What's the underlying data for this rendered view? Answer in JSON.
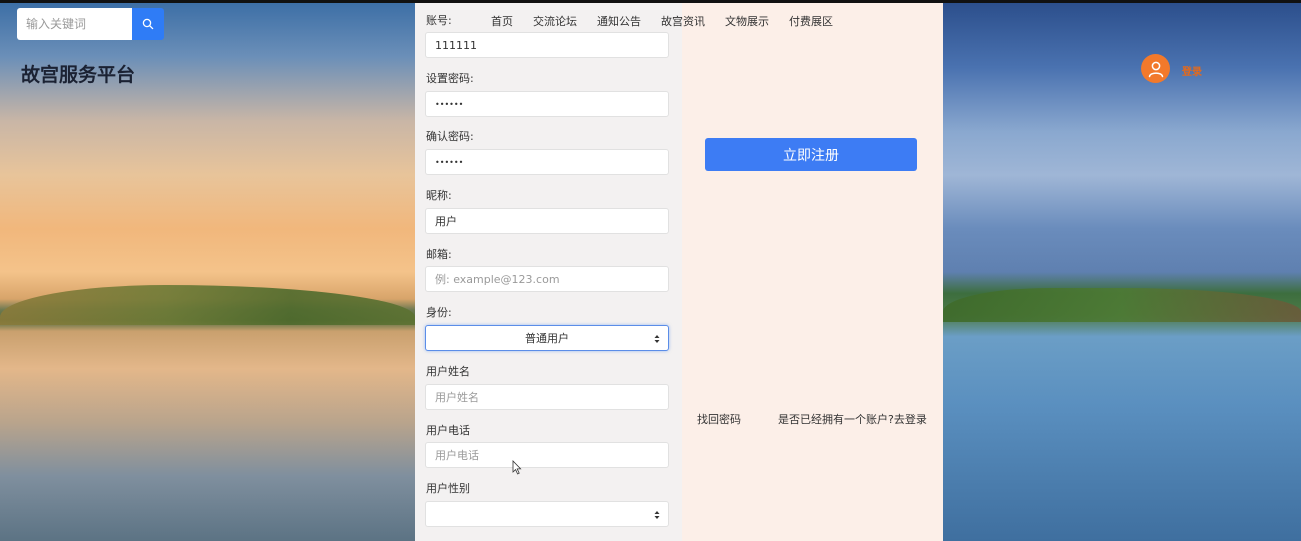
{
  "search": {
    "placeholder": "输入关键词",
    "icon": "search-icon"
  },
  "site": {
    "title": "故宫服务平台"
  },
  "user": {
    "login_label": "登录",
    "avatar_icon": "user-icon"
  },
  "nav": {
    "items": [
      {
        "label": "首页"
      },
      {
        "label": "交流论坛"
      },
      {
        "label": "通知公告"
      },
      {
        "label": "故宫资讯"
      },
      {
        "label": "文物展示"
      },
      {
        "label": "付费展区"
      }
    ]
  },
  "form": {
    "account": {
      "label": "账号:",
      "value": "111111"
    },
    "password": {
      "label": "设置密码:",
      "value": "••••••"
    },
    "confirm_password": {
      "label": "确认密码:",
      "value": "••••••"
    },
    "nickname": {
      "label": "昵称:",
      "value": "用户"
    },
    "email": {
      "label": "邮箱:",
      "placeholder": "例: example@123.com"
    },
    "identity": {
      "label": "身份:",
      "selected": "普通用户"
    },
    "real_name": {
      "label": "用户姓名",
      "placeholder": "用户姓名"
    },
    "phone": {
      "label": "用户电话",
      "placeholder": "用户电话"
    },
    "gender": {
      "label": "用户性别",
      "selected": ""
    }
  },
  "actions": {
    "register_label": "立即注册",
    "forgot_password": "找回密码",
    "has_account": "是否已经拥有一个账户?去登录"
  },
  "colors": {
    "accent_blue": "#3d7cf4",
    "search_blue": "#2f7cf6",
    "avatar_orange": "#f2792b",
    "form_bg": "#f3f1f1",
    "panel_bg": "#fcefe8"
  }
}
